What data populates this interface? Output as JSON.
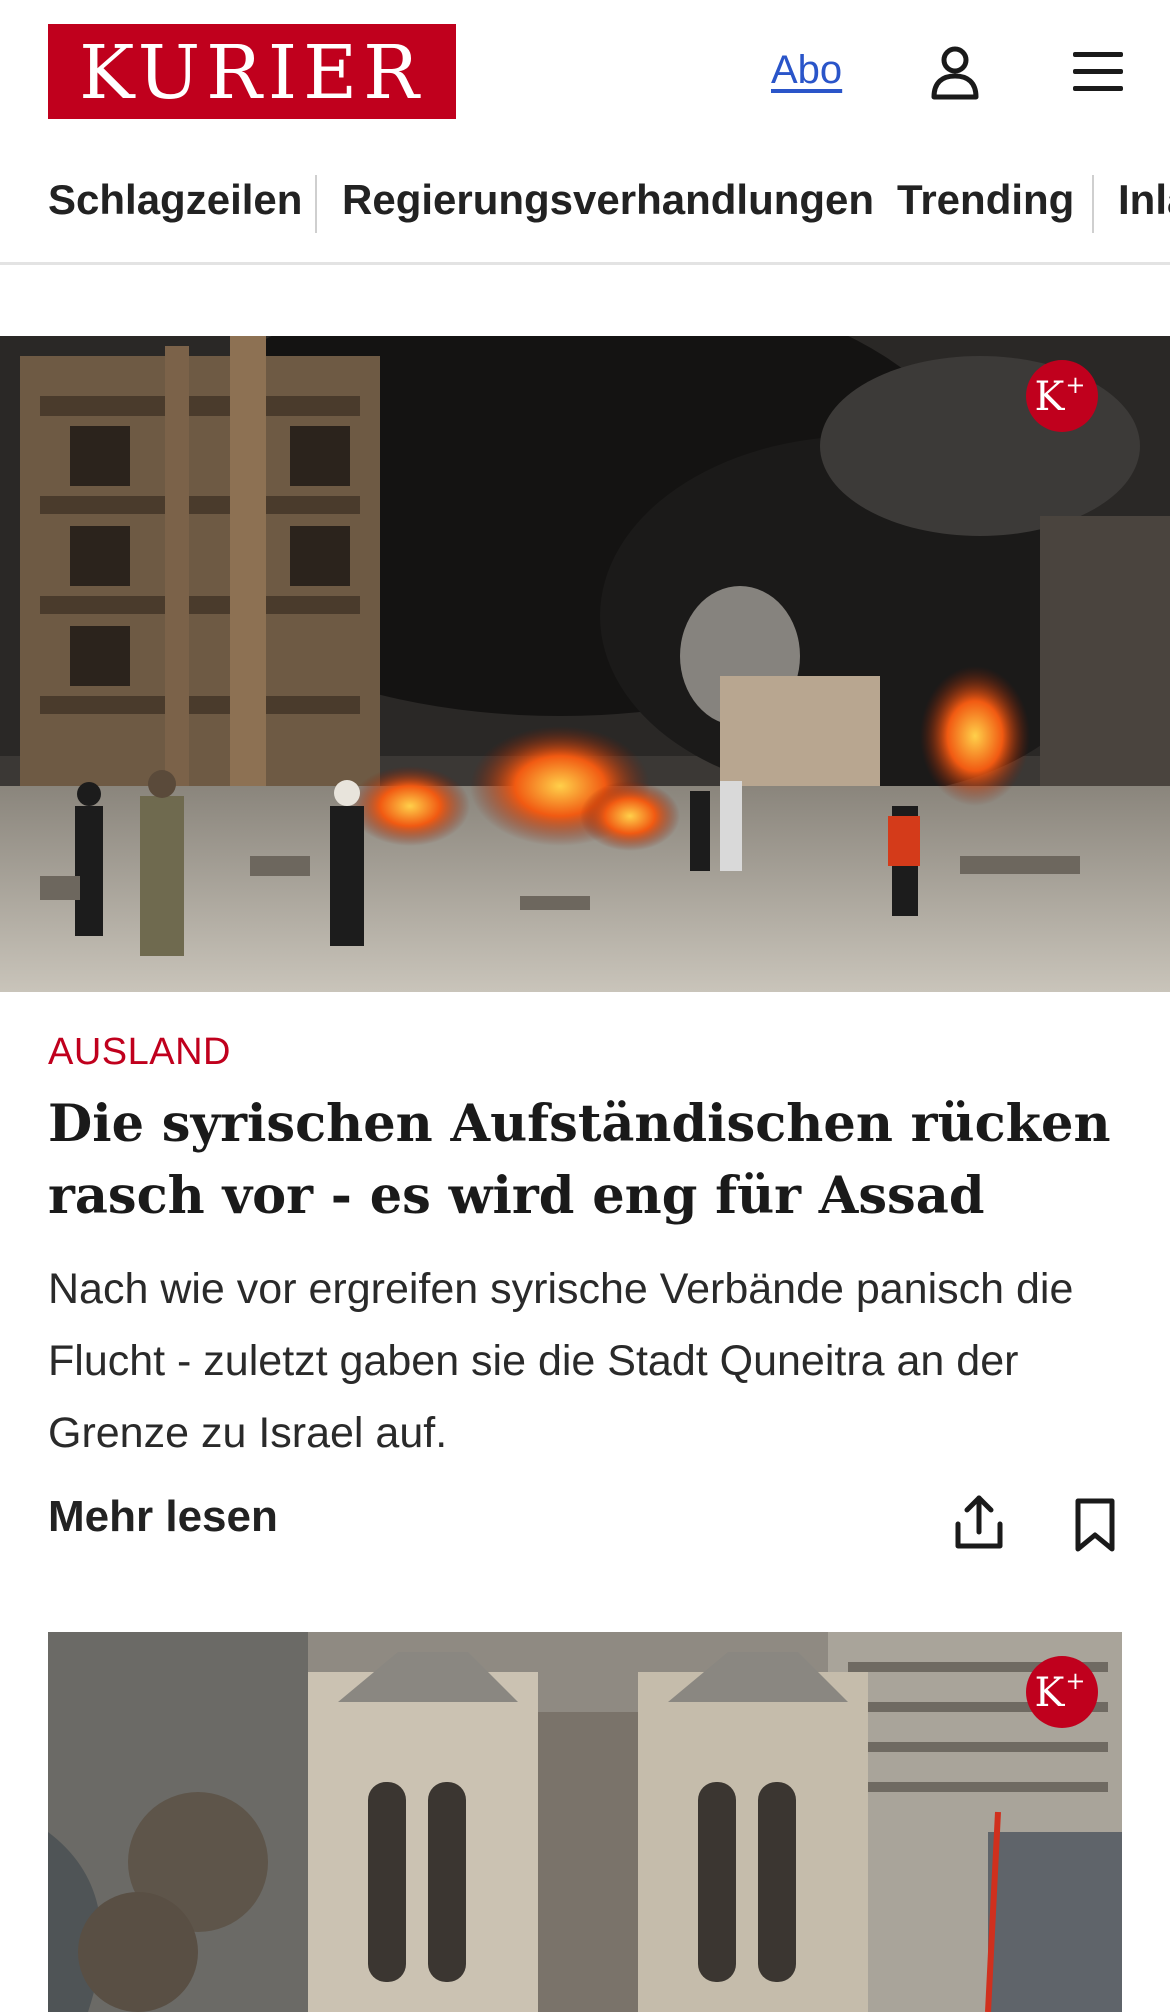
{
  "header": {
    "logo_text": "KURIER",
    "abo_label": "Abo",
    "user_icon": "user-icon",
    "menu_icon": "hamburger-menu-icon"
  },
  "nav": {
    "tabs": [
      {
        "label": "Schlagzeilen"
      },
      {
        "label": "Regierungsverhandlungen"
      },
      {
        "label": "Trending"
      },
      {
        "label": "Inland"
      }
    ]
  },
  "articles": [
    {
      "badge": "K",
      "badge_plus": "+",
      "category": "AUSLAND",
      "headline": "Die syrischen Aufständischen rücken rasch vor - es wird eng für Assad",
      "teaser": "Nach wie vor ergreifen syrische Verbände panisch die Flucht - zuletzt gaben sie die Stadt Quneitra an der Grenze zu Israel auf.",
      "more_label": "Mehr lesen",
      "share_icon": "share-icon",
      "bookmark_icon": "bookmark-icon"
    },
    {
      "badge": "K",
      "badge_plus": "+"
    }
  ],
  "colors": {
    "brand_red": "#c0001d",
    "link_blue": "#2a55c9"
  }
}
